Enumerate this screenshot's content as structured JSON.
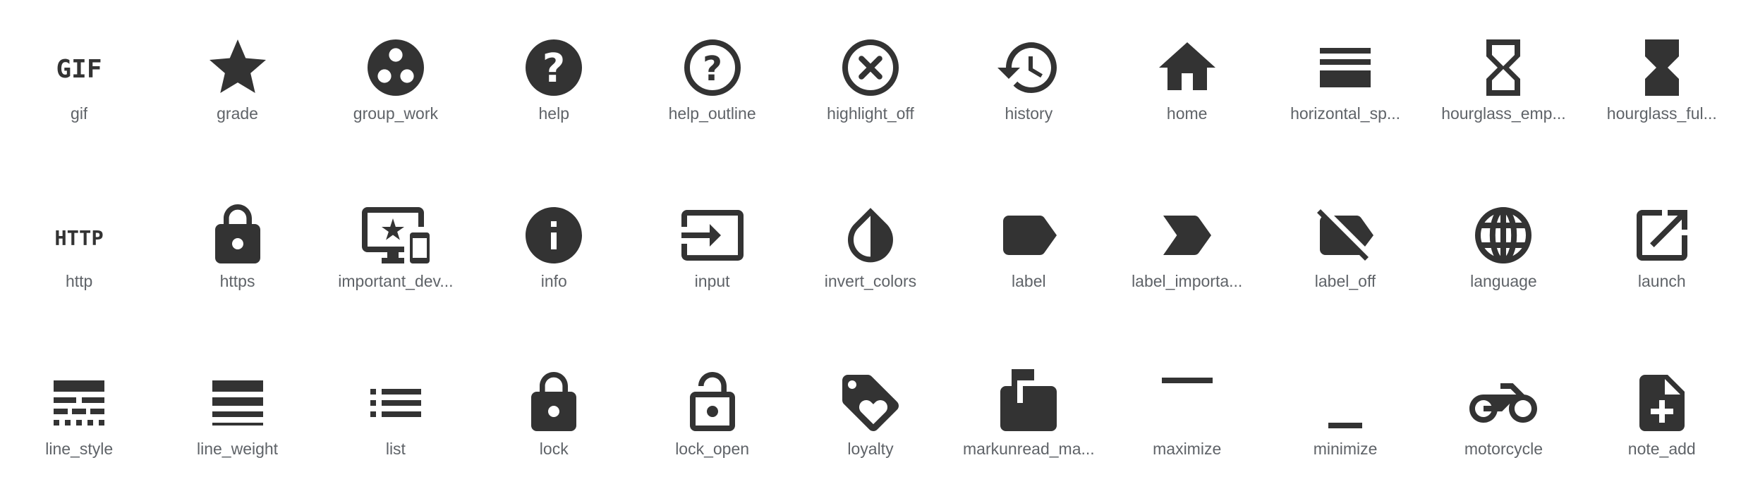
{
  "icons": [
    {
      "label": "gif",
      "icon": "gif-icon"
    },
    {
      "label": "grade",
      "icon": "grade-icon"
    },
    {
      "label": "group_work",
      "icon": "group-work-icon"
    },
    {
      "label": "help",
      "icon": "help-icon"
    },
    {
      "label": "help_outline",
      "icon": "help-outline-icon"
    },
    {
      "label": "highlight_off",
      "icon": "highlight-off-icon"
    },
    {
      "label": "history",
      "icon": "history-icon"
    },
    {
      "label": "home",
      "icon": "home-icon"
    },
    {
      "label": "horizontal_sp...",
      "icon": "horizontal-split-icon"
    },
    {
      "label": "hourglass_emp...",
      "icon": "hourglass-empty-icon"
    },
    {
      "label": "hourglass_ful...",
      "icon": "hourglass-full-icon"
    },
    {
      "label": "http",
      "icon": "http-icon"
    },
    {
      "label": "https",
      "icon": "https-icon"
    },
    {
      "label": "important_dev...",
      "icon": "important-devices-icon"
    },
    {
      "label": "info",
      "icon": "info-icon"
    },
    {
      "label": "input",
      "icon": "input-icon"
    },
    {
      "label": "invert_colors",
      "icon": "invert-colors-icon"
    },
    {
      "label": "label",
      "icon": "label-icon"
    },
    {
      "label": "label_importa...",
      "icon": "label-important-icon"
    },
    {
      "label": "label_off",
      "icon": "label-off-icon"
    },
    {
      "label": "language",
      "icon": "language-icon"
    },
    {
      "label": "launch",
      "icon": "launch-icon"
    },
    {
      "label": "line_style",
      "icon": "line-style-icon"
    },
    {
      "label": "line_weight",
      "icon": "line-weight-icon"
    },
    {
      "label": "list",
      "icon": "list-icon"
    },
    {
      "label": "lock",
      "icon": "lock-icon"
    },
    {
      "label": "lock_open",
      "icon": "lock-open-icon"
    },
    {
      "label": "loyalty",
      "icon": "loyalty-icon"
    },
    {
      "label": "markunread_ma...",
      "icon": "markunread-mailbox-icon"
    },
    {
      "label": "maximize",
      "icon": "maximize-icon"
    },
    {
      "label": "minimize",
      "icon": "minimize-icon"
    },
    {
      "label": "motorcycle",
      "icon": "motorcycle-icon"
    },
    {
      "label": "note_add",
      "icon": "note-add-icon"
    }
  ],
  "colors": {
    "icon": "#333333",
    "label": "#5f6368",
    "background": "#ffffff"
  }
}
